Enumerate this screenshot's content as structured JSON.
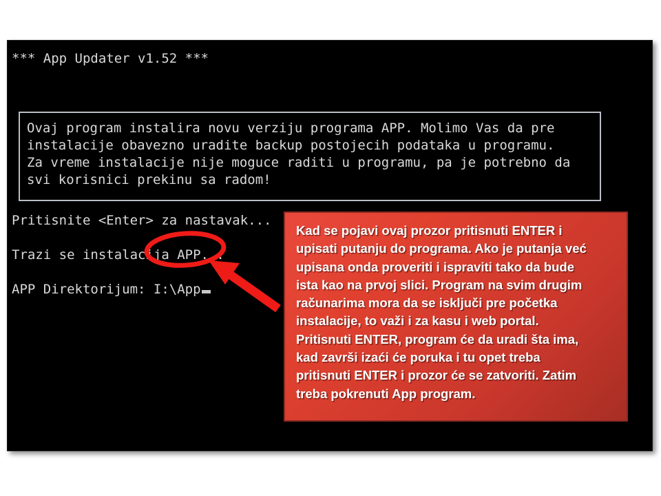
{
  "console": {
    "title": "*** App Updater v1.52 ***",
    "message_box_lines": [
      "Ovaj program instalira novu verziju programa APP. Molimo Vas da pre",
      "instalacije obavezno uradite backup postojecih podataka u programu.",
      "Za vreme instalacije nije moguce raditi u programu, pa je potrebno da",
      "svi korisnici prekinu sa radom!"
    ],
    "message_box_text": "Ovaj program instalira novu verziju programa APP. Molimo Vas da pre\ninstalacije obavezno uradite backup postojecih podataka u programu.\nZa vreme instalacije nije moguce raditi u programu, pa je potrebno da\nsvi korisnici prekinu sa radom!",
    "prompt_enter": "Pritisnite <Enter> za nastavak...",
    "status_searching": "Trazi se instalacija APP...",
    "directory_label": "APP Direktorijum: ",
    "directory_value": "I:\\App",
    "foreground_color": "#d9d9d9",
    "background_color": "#000000",
    "box_border_color": "#b9bec8"
  },
  "annotations": {
    "highlight_ellipse": {
      "name": "red-ellipse-highlight",
      "color": "#ee1b17"
    },
    "arrow": {
      "name": "red-arrow",
      "color": "#ee1b17"
    },
    "callout": {
      "color": "#d8382c",
      "border_color": "#8d2a22",
      "text_color": "#ffffff",
      "text": "Kad se pojavi ovaj prozor pritisnuti ENTER i\nupisati putanju do programa. Ako je putanja već\nupisana onda proveriti i ispraviti tako da bude\nista kao na prvoj slici. Program na svim drugim\nračunarima mora da se isključi pre početka\ninstalacije, to važi i za kasu i web portal.\nPritisnuti ENTER, program će da uradi šta ima,\nkad završi izaći će poruka i tu opet treba\npritisnuti ENTER i prozor će se zatvoriti. Zatim\ntreba pokrenuti App program."
    }
  }
}
